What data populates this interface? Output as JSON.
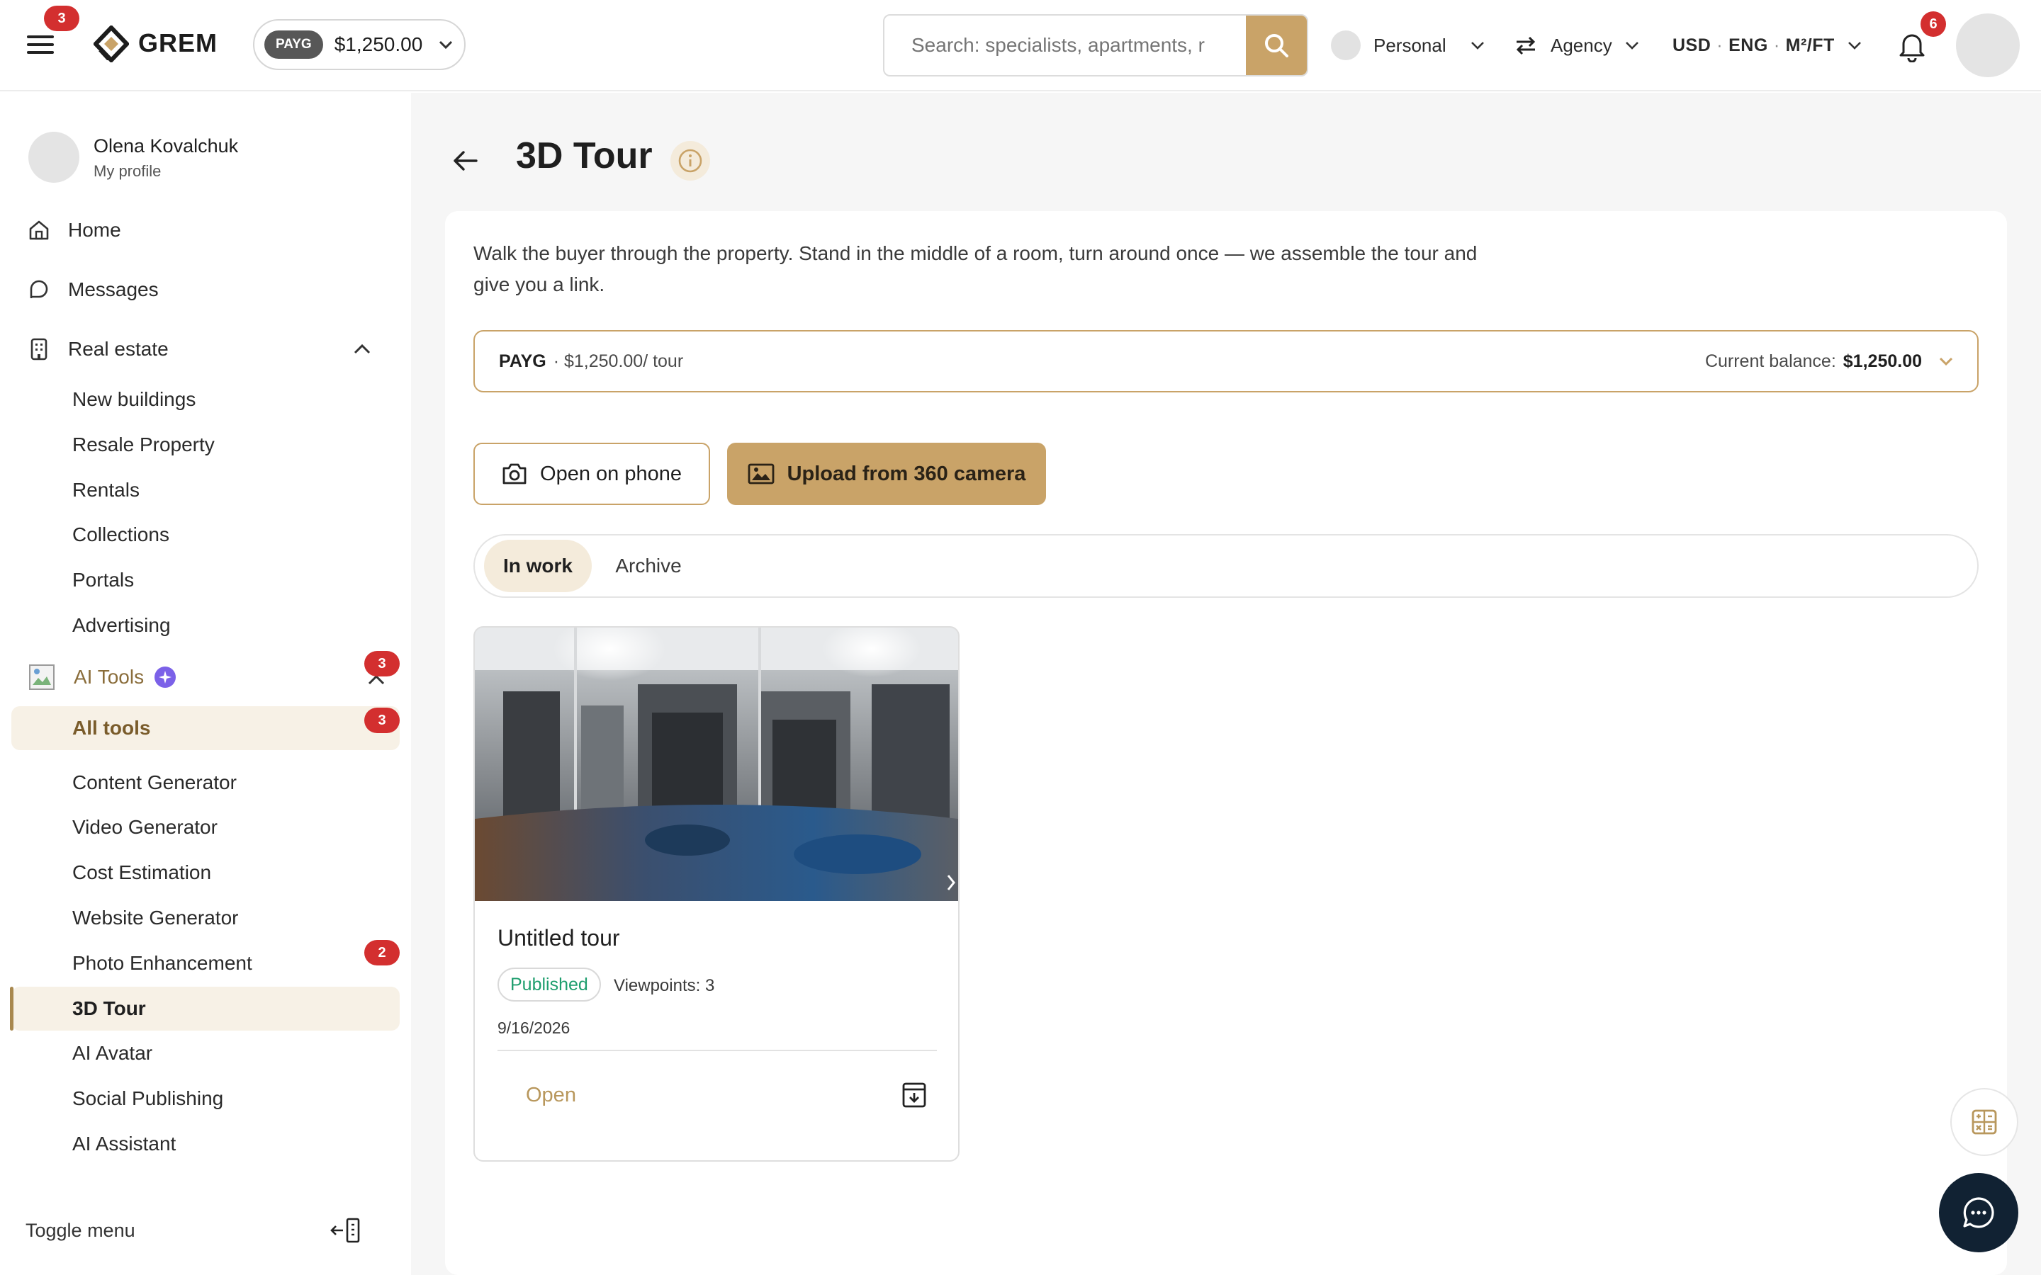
{
  "header": {
    "notification_count_menu": "3",
    "logo_text": "GREM",
    "plan_chip": "PAYG",
    "balance": "$1,250.00",
    "search_placeholder": "Search: specialists, apartments, r",
    "account_mode": "Personal",
    "agency_label": "Agency",
    "currency": "USD",
    "language": "ENG",
    "area_unit": "M²/FT",
    "notifications_count": "6"
  },
  "sidebar": {
    "profile_name": "Olena Kovalchuk",
    "profile_sub": "My profile",
    "home": "Home",
    "messages": "Messages",
    "real_estate": "Real estate",
    "real_estate_items": [
      "New buildings",
      "Resale Property",
      "Rentals",
      "Collections",
      "Portals",
      "Advertising"
    ],
    "ai_tools": "AI Tools",
    "ai_tools_badge": "3",
    "all_tools": "All tools",
    "all_tools_badge": "3",
    "ai_items": [
      "Content Generator",
      "Video Generator",
      "Cost Estimation",
      "Website Generator",
      "Photo Enhancement",
      "3D Tour",
      "AI Avatar",
      "Social Publishing",
      "AI Assistant"
    ],
    "photo_enhancement_badge": "2",
    "toggle_menu": "Toggle menu"
  },
  "main": {
    "title": "3D Tour",
    "description": "Walk the buyer through the property. Stand in the middle of a room, turn around once — we assemble the tour and give you a link.",
    "plan": {
      "name": "PAYG",
      "price": "· $1,250.00/ tour",
      "balance_label": "Current balance:",
      "balance_value": "$1,250.00"
    },
    "buttons": {
      "open_on_phone": "Open on phone",
      "upload_360": "Upload from 360 camera"
    },
    "tabs": [
      {
        "label": "In work",
        "active": true
      },
      {
        "label": "Archive",
        "active": false
      }
    ],
    "tour_card": {
      "title": "Untitled tour",
      "status": "Published",
      "viewpoints": "Viewpoints: 3",
      "date": "9/16/2026",
      "open_label": "Open"
    }
  },
  "colors": {
    "accent_gold": "#c9a368",
    "active_bg": "#f7f1e6",
    "badge_red": "#d32f2f",
    "published_green": "#1e9e6e",
    "chat_fab": "#112233"
  }
}
